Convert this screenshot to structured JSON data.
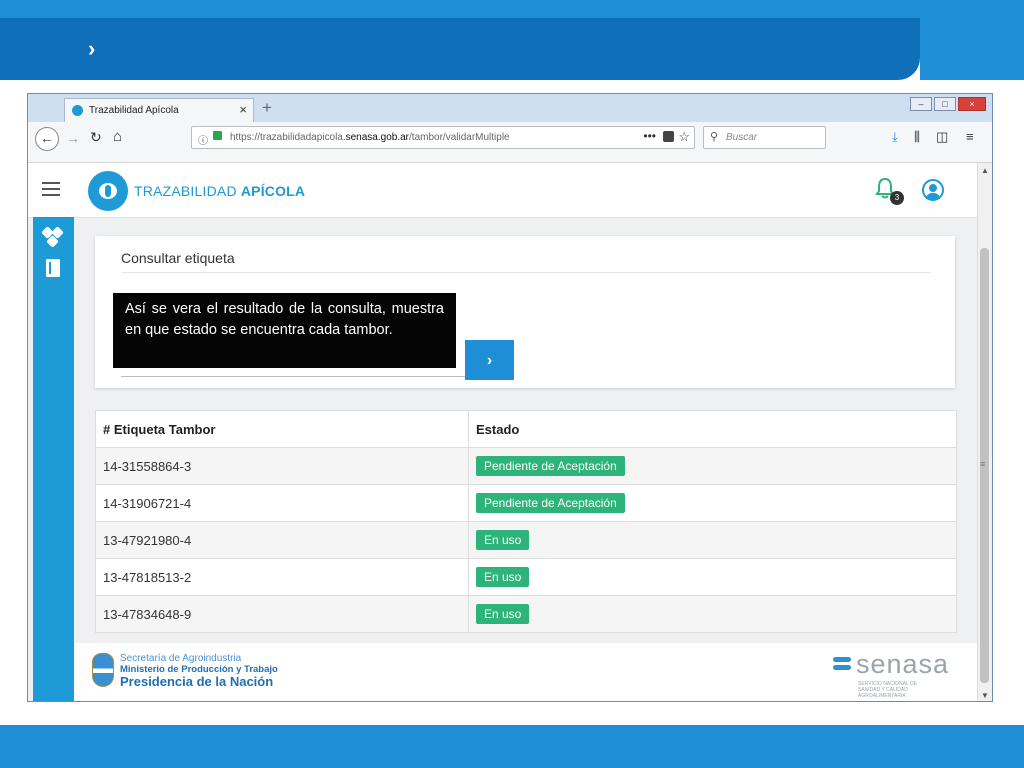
{
  "slide": {
    "chevron": "›"
  },
  "browser": {
    "tab_title": "Trazabilidad Apícola",
    "tab_close": "×",
    "new_tab": "+",
    "window_buttons": [
      "–",
      "□",
      "×"
    ],
    "url_prefix": "https://trazabilidadapicola.",
    "url_domain": "senasa.gob.ar",
    "url_path": "/tambor/validarMultiple",
    "url_dots": "•••",
    "search_placeholder": "Buscar"
  },
  "app": {
    "logo_text_light": "TRAZABILIDAD ",
    "logo_text_bold": "APÍCOLA",
    "notification_count": "3"
  },
  "card": {
    "title": "Consultar etiqueta",
    "go_button": "›"
  },
  "tooltip": {
    "text": "Así se vera el resultado de la consulta, muestra en que estado se encuentra cada tambor."
  },
  "table": {
    "headers": [
      "# Etiqueta Tambor",
      "Estado"
    ],
    "rows": [
      {
        "etiqueta": "14-31558864-3",
        "estado": "Pendiente de Aceptación"
      },
      {
        "etiqueta": "14-31906721-4",
        "estado": "Pendiente de Aceptación"
      },
      {
        "etiqueta": "13-47921980-4",
        "estado": "En uso"
      },
      {
        "etiqueta": "13-47818513-2",
        "estado": "En uso"
      },
      {
        "etiqueta": "13-47834648-9",
        "estado": "En uso"
      }
    ]
  },
  "footer": {
    "gov_line1": "Secretaría de Agroindustria",
    "gov_line2": "Ministerio de Producción y Trabajo",
    "gov_line3": "Presidencia de la Nación",
    "senasa": "senasa",
    "senasa_sub": "SERVICIO NACIONAL DE SANIDAD Y CALIDAD AGROALIMENTARIA"
  },
  "colors": {
    "brand_blue": "#1e9ad6",
    "badge_green": "#2eb37a",
    "slide_blue": "#0f6fb8"
  }
}
